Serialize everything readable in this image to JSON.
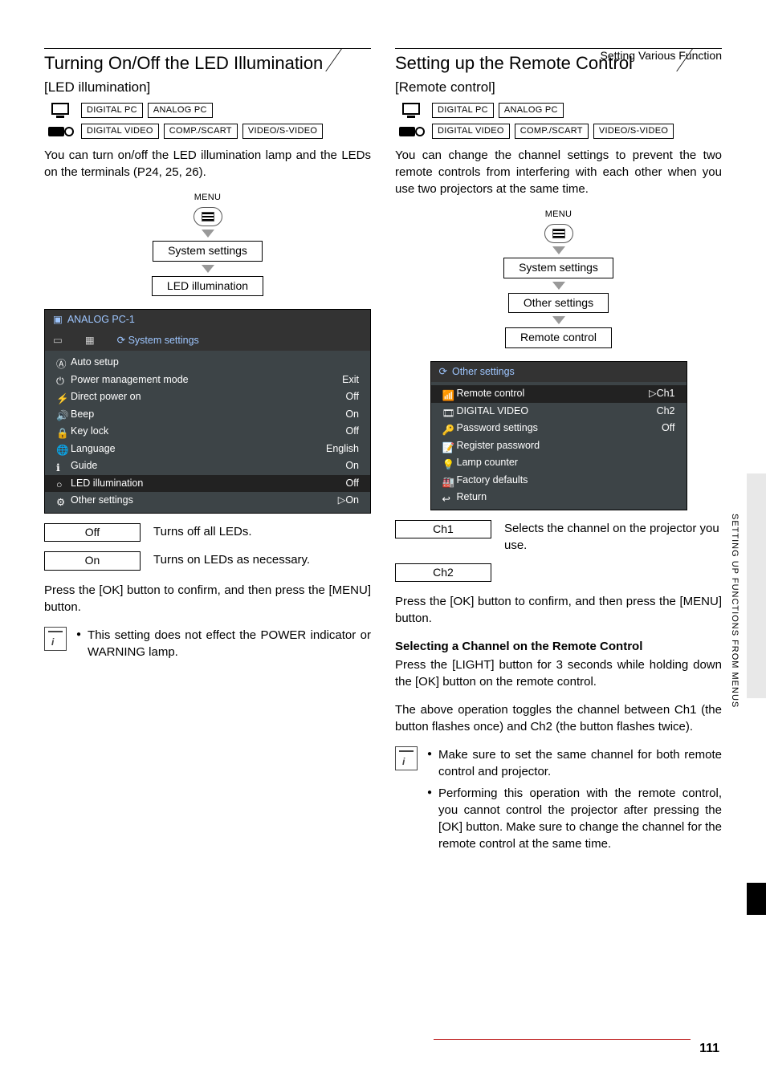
{
  "header": "Setting Various Function",
  "page_number": "111",
  "side_label": "SETTING UP FUNCTIONS FROM MENUS",
  "left": {
    "title": "Turning On/Off the LED Illumination",
    "subhead": "[LED illumination]",
    "badges": {
      "row1": [
        "DIGITAL PC",
        "ANALOG PC"
      ],
      "row2": [
        "DIGITAL VIDEO",
        "COMP./SCART",
        "VIDEO/S-VIDEO"
      ]
    },
    "desc": "You can turn on/off the LED illumination lamp and the LEDs on the terminals (P24, 25, 26).",
    "menu_label": "MENU",
    "path": [
      "System settings",
      "LED illumination"
    ],
    "osd": {
      "top": "ANALOG PC-1",
      "tab": "System settings",
      "rows": [
        {
          "l": "Auto setup",
          "r": "",
          "icon": "Ⓐ"
        },
        {
          "l": "Power management mode",
          "r": "Exit",
          "icon": "⏻"
        },
        {
          "l": "Direct power on",
          "r": "Off",
          "icon": "⚡"
        },
        {
          "l": "Beep",
          "r": "On",
          "icon": "🔊"
        },
        {
          "l": "Key lock",
          "r": "Off",
          "icon": "🔒"
        },
        {
          "l": "Language",
          "r": "English",
          "icon": "🌐"
        },
        {
          "l": "Guide",
          "r": "On",
          "icon": "ℹ"
        },
        {
          "l": "LED illumination",
          "r": "Off",
          "icon": "○",
          "hl": true
        },
        {
          "l": "Other settings",
          "r": "▷On",
          "icon": "⚙"
        }
      ]
    },
    "options": [
      {
        "box": "Off",
        "desc": "Turns off all LEDs."
      },
      {
        "box": "On",
        "desc": "Turns on LEDs as necessary."
      }
    ],
    "after": "Press the [OK] button to confirm, and then press the [MENU] button.",
    "note": "This setting does not effect the POWER indicator or WARNING lamp."
  },
  "right": {
    "title": "Setting up the Remote Control",
    "subhead": "[Remote control]",
    "badges": {
      "row1": [
        "DIGITAL PC",
        "ANALOG PC"
      ],
      "row2": [
        "DIGITAL VIDEO",
        "COMP./SCART",
        "VIDEO/S-VIDEO"
      ]
    },
    "desc": "You can change the channel settings to prevent the two remote controls from interfering with each other when you use two projectors at the same time.",
    "menu_label": "MENU",
    "path": [
      "System settings",
      "Other settings",
      "Remote control"
    ],
    "osd": {
      "top": "Other settings",
      "rows": [
        {
          "l": "Remote control",
          "r": "▷Ch1",
          "icon": "📶",
          "hl": true
        },
        {
          "l": "DIGITAL VIDEO",
          "r": "Ch2",
          "icon": "🎞"
        },
        {
          "l": "Password settings",
          "r": "Off",
          "icon": "🔑"
        },
        {
          "l": "Register password",
          "r": "",
          "icon": "📝"
        },
        {
          "l": "Lamp counter",
          "r": "",
          "icon": "💡"
        },
        {
          "l": "Factory defaults",
          "r": "",
          "icon": "🏭"
        },
        {
          "l": "Return",
          "r": "",
          "icon": "↩"
        }
      ]
    },
    "options": [
      {
        "box": "Ch1",
        "desc": "Selects the channel on the projector you use."
      },
      {
        "box": "Ch2",
        "desc": ""
      }
    ],
    "after": "Press the [OK] button to confirm, and then press the [MENU] button.",
    "sub_heading": "Selecting a Channel on the Remote Control",
    "sub_p1": "Press the [LIGHT] button for 3 seconds while holding down the [OK] button on the remote control.",
    "sub_p2": "The above operation toggles the channel between Ch1 (the button flashes once) and Ch2 (the button flashes twice).",
    "notes": [
      "Make sure to set the same channel for both remote control and projector.",
      "Performing this operation with the remote control, you cannot control the projector after pressing the [OK] button. Make sure to change the channel for the remote control at the same time."
    ]
  }
}
